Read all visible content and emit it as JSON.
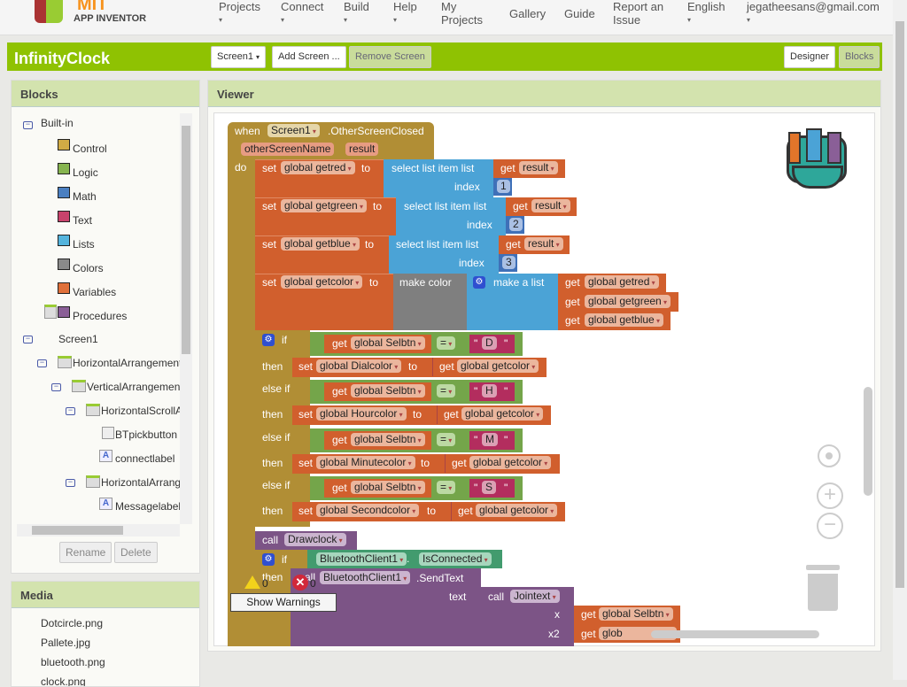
{
  "header": {
    "logo_top": "MIT",
    "logo_bottom": "APP INVENTOR",
    "nav": [
      "Projects",
      "Connect",
      "Build",
      "Help",
      "My Projects",
      "Gallery",
      "Guide",
      "Report an Issue",
      "English",
      "jegatheesans@gmail.com"
    ]
  },
  "project": {
    "title": "InfinityClock",
    "screen_select": "Screen1",
    "add_screen": "Add Screen ...",
    "remove_screen": "Remove Screen",
    "designer": "Designer",
    "blocks": "Blocks"
  },
  "blocks_panel": {
    "title": "Blocks",
    "builtin": "Built-in",
    "categories": [
      {
        "label": "Control",
        "color": "#d1ab45"
      },
      {
        "label": "Logic",
        "color": "#86b44f"
      },
      {
        "label": "Math",
        "color": "#4a7fc1"
      },
      {
        "label": "Text",
        "color": "#c8436c"
      },
      {
        "label": "Lists",
        "color": "#54b4dd"
      },
      {
        "label": "Colors",
        "color": "#8a8a8a"
      },
      {
        "label": "Variables",
        "color": "#e0703a"
      },
      {
        "label": "Procedures",
        "color": "#8a5f97"
      }
    ],
    "components": [
      "Screen1",
      "HorizontalArrangement",
      "VerticalArrangement",
      "HorizontalScrollArrangement",
      "BTpickbutton",
      "connectlabel",
      "HorizontalArrangement",
      "Messagelabel"
    ],
    "rename": "Rename",
    "delete": "Delete"
  },
  "media": {
    "title": "Media",
    "files": [
      "Dotcircle.png",
      "Pallete.jpg",
      "bluetooth.png",
      "clock.png"
    ]
  },
  "viewer": {
    "title": "Viewer",
    "event": {
      "when": "when",
      "component": "Screen1",
      "event": ".OtherScreenClosed",
      "param1": "otherScreenName",
      "param2": "result",
      "do": "do"
    },
    "kw": {
      "set": "set",
      "to": "to",
      "get": "get",
      "select": "select list item  list",
      "index": "index",
      "make_color": "make color",
      "make_list": "make a list",
      "if": "if",
      "then": "then",
      "else_if": "else if",
      "eq": "=",
      "call": "call",
      "dot": ".",
      "text": "text",
      "x": "x",
      "x2": "x2",
      "q": "\""
    },
    "sets": [
      {
        "var": "global getred",
        "src": "result",
        "idx": "1"
      },
      {
        "var": "global getgreen",
        "src": "result",
        "idx": "2"
      },
      {
        "var": "global getblue",
        "src": "result",
        "idx": "3"
      }
    ],
    "getcolor": {
      "var": "global getcolor",
      "items": [
        "global getred",
        "global getgreen",
        "global getblue"
      ]
    },
    "branches": [
      {
        "test_var": "global Selbtn",
        "test_val": "D",
        "set_var": "global Dialcolor",
        "value": "global getcolor"
      },
      {
        "test_var": "global Selbtn",
        "test_val": "H",
        "set_var": "global Hourcolor",
        "value": "global getcolor"
      },
      {
        "test_var": "global Selbtn",
        "test_val": "M",
        "set_var": "global Minutecolor",
        "value": "global getcolor"
      },
      {
        "test_var": "global Selbtn",
        "test_val": "S",
        "set_var": "global Secondcolor",
        "value": "global getcolor"
      }
    ],
    "drawclock": "Drawclock",
    "bt": {
      "component": "BluetoothClient1",
      "prop": "IsConnected",
      "method": ".SendText",
      "proc": "Jointext",
      "x_var": "global Selbtn",
      "x2_var": "glob"
    },
    "warnings": {
      "warn_count": "0",
      "error_count": "0",
      "button": "Show Warnings"
    }
  }
}
